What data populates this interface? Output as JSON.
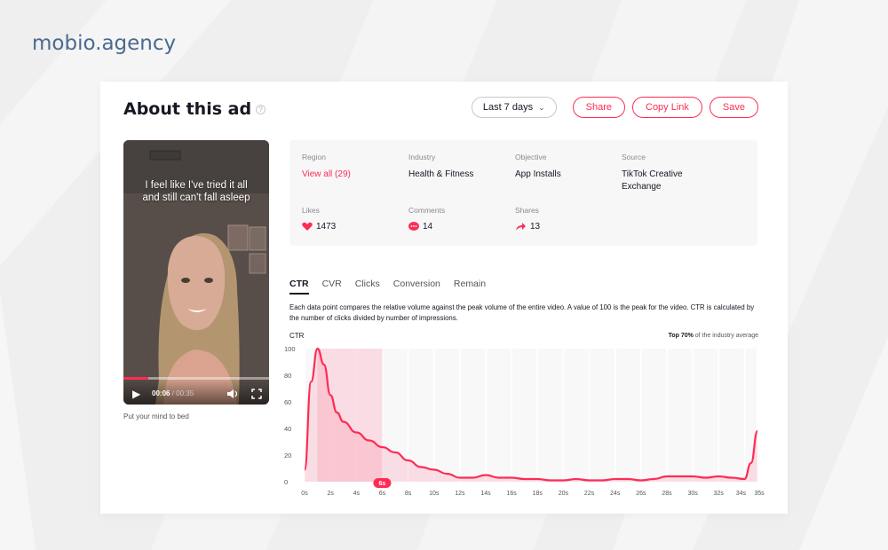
{
  "brand": "mobio.agency",
  "page": {
    "title": "About this ad",
    "help_icon": "question-circle-icon",
    "accent_color": "#fe2c55"
  },
  "actions": {
    "date_range": "Last 7 days",
    "share": "Share",
    "copy_link": "Copy Link",
    "save": "Save"
  },
  "video": {
    "caption_line1": "I feel like I've tried it all",
    "caption_line2": "and still can't fall asleep",
    "current_time": "00:06",
    "duration": "/ 00:35",
    "progress_fraction": 0.17,
    "title": "Put your mind to bed"
  },
  "info": {
    "region_label": "Region",
    "region_value": "View all (29)",
    "industry_label": "Industry",
    "industry_value": "Health & Fitness",
    "objective_label": "Objective",
    "objective_value": "App Installs",
    "source_label": "Source",
    "source_value_line1": "TikTok Creative",
    "source_value_line2": "Exchange",
    "likes_label": "Likes",
    "likes_value": "1473",
    "comments_label": "Comments",
    "comments_value": "14",
    "shares_label": "Shares",
    "shares_value": "13"
  },
  "tabs": [
    "CTR",
    "CVR",
    "Clicks",
    "Conversion",
    "Remain"
  ],
  "active_tab": "CTR",
  "description": "Each data point compares the relative volume against the peak volume of the entire video. A value of 100 is the peak for the video. CTR is calculated by the number of clicks divided by number of impressions.",
  "chart_data": {
    "type": "area",
    "ylabel": "CTR",
    "note_bold": "Top 70%",
    "note_rest": " of the industry average",
    "ylim": [
      0,
      100
    ],
    "y_ticks": [
      0,
      20,
      40,
      60,
      80,
      100
    ],
    "x_ticks": [
      "0s",
      "2s",
      "4s",
      "6s",
      "8s",
      "10s",
      "12s",
      "14s",
      "16s",
      "18s",
      "20s",
      "22s",
      "24s",
      "26s",
      "28s",
      "30s",
      "32s",
      "34s",
      "35s"
    ],
    "highlight_range": [
      1,
      6
    ],
    "marker_label": "6s",
    "x": [
      0,
      0.5,
      1,
      1.5,
      2,
      2.5,
      3,
      4,
      5,
      6,
      7,
      8,
      9,
      10,
      11,
      12,
      13,
      14,
      15,
      16,
      17,
      18,
      19,
      20,
      21,
      22,
      23,
      24,
      25,
      26,
      27,
      28,
      29,
      30,
      31,
      32,
      33,
      34,
      34.5,
      35
    ],
    "y": [
      9,
      75,
      100,
      88,
      65,
      52,
      45,
      37,
      31,
      26,
      22,
      16,
      11,
      9,
      6,
      3,
      3,
      5,
      3,
      3,
      2,
      2,
      1,
      1,
      2,
      1,
      1,
      2,
      2,
      1,
      2,
      4,
      4,
      4,
      3,
      4,
      3,
      2,
      14,
      38
    ]
  }
}
